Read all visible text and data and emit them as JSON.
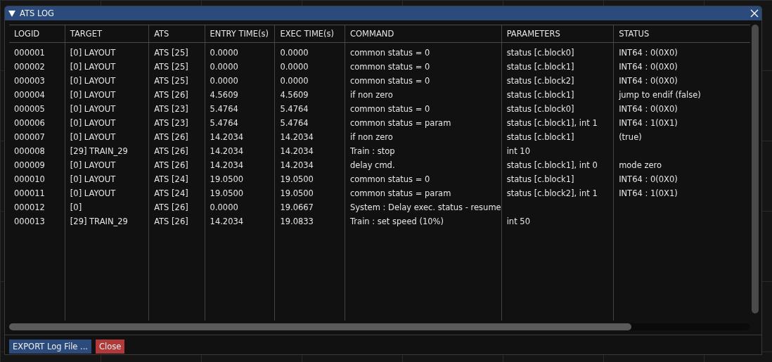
{
  "window": {
    "title": "ATS LOG"
  },
  "table": {
    "columns": [
      "LOGID",
      "TARGET",
      "ATS",
      "ENTRY TIME(s)",
      "EXEC TIME(s)",
      "COMMAND",
      "PARAMETERS",
      "STATUS"
    ],
    "rows": [
      [
        "000001",
        "[0] LAYOUT",
        "ATS [25]",
        "0.0000",
        "0.0000",
        "common status = 0",
        "status [c.block0]",
        "INT64 : 0(0X0)"
      ],
      [
        "000002",
        "[0] LAYOUT",
        "ATS [25]",
        "0.0000",
        "0.0000",
        "common status = 0",
        "status [c.block1]",
        "INT64 : 0(0X0)"
      ],
      [
        "000003",
        "[0] LAYOUT",
        "ATS [25]",
        "0.0000",
        "0.0000",
        "common status = 0",
        "status [c.block2]",
        "INT64 : 0(0X0)"
      ],
      [
        "000004",
        "[0] LAYOUT",
        "ATS [26]",
        "4.5609",
        "4.5609",
        "if non zero",
        "status [c.block1]",
        " jump to endif (false)"
      ],
      [
        "000005",
        "[0] LAYOUT",
        "ATS [23]",
        "5.4764",
        "5.4764",
        "common status = 0",
        "status [c.block0]",
        "INT64 : 0(0X0)"
      ],
      [
        "000006",
        "[0] LAYOUT",
        "ATS [23]",
        "5.4764",
        "5.4764",
        "common status = param",
        "status [c.block1], int 1",
        "INT64 : 1(0X1)"
      ],
      [
        "000007",
        "[0] LAYOUT",
        "ATS [26]",
        "14.2034",
        "14.2034",
        "if non zero",
        "status [c.block1]",
        " (true)"
      ],
      [
        "000008",
        "[29] TRAIN_29",
        "ATS [26]",
        "14.2034",
        "14.2034",
        "Train : stop",
        "int 10",
        ""
      ],
      [
        "000009",
        "[0] LAYOUT",
        "ATS [26]",
        "14.2034",
        "14.2034",
        "delay cmd.",
        "status [c.block1], int 0",
        "mode zero"
      ],
      [
        "000010",
        "[0] LAYOUT",
        "ATS [24]",
        "19.0500",
        "19.0500",
        "common status = 0",
        "status [c.block1]",
        "INT64 : 0(0X0)"
      ],
      [
        "000011",
        "[0] LAYOUT",
        "ATS [24]",
        "19.0500",
        "19.0500",
        "common status = param",
        "status [c.block2], int 1",
        "INT64 : 1(0X1)"
      ],
      [
        "000012",
        "[0]",
        "ATS [26]",
        "0.0000",
        "19.0667",
        "System : Delay exec. status - resume",
        "",
        ""
      ],
      [
        "000013",
        "[29] TRAIN_29",
        "ATS [26]",
        "14.2034",
        "19.0833",
        "Train : set speed (10%)",
        "int 50",
        ""
      ]
    ]
  },
  "buttons": [
    {
      "label": "EXPORT Log File ...",
      "kind": "primary"
    },
    {
      "label": "Close",
      "kind": "danger"
    }
  ]
}
